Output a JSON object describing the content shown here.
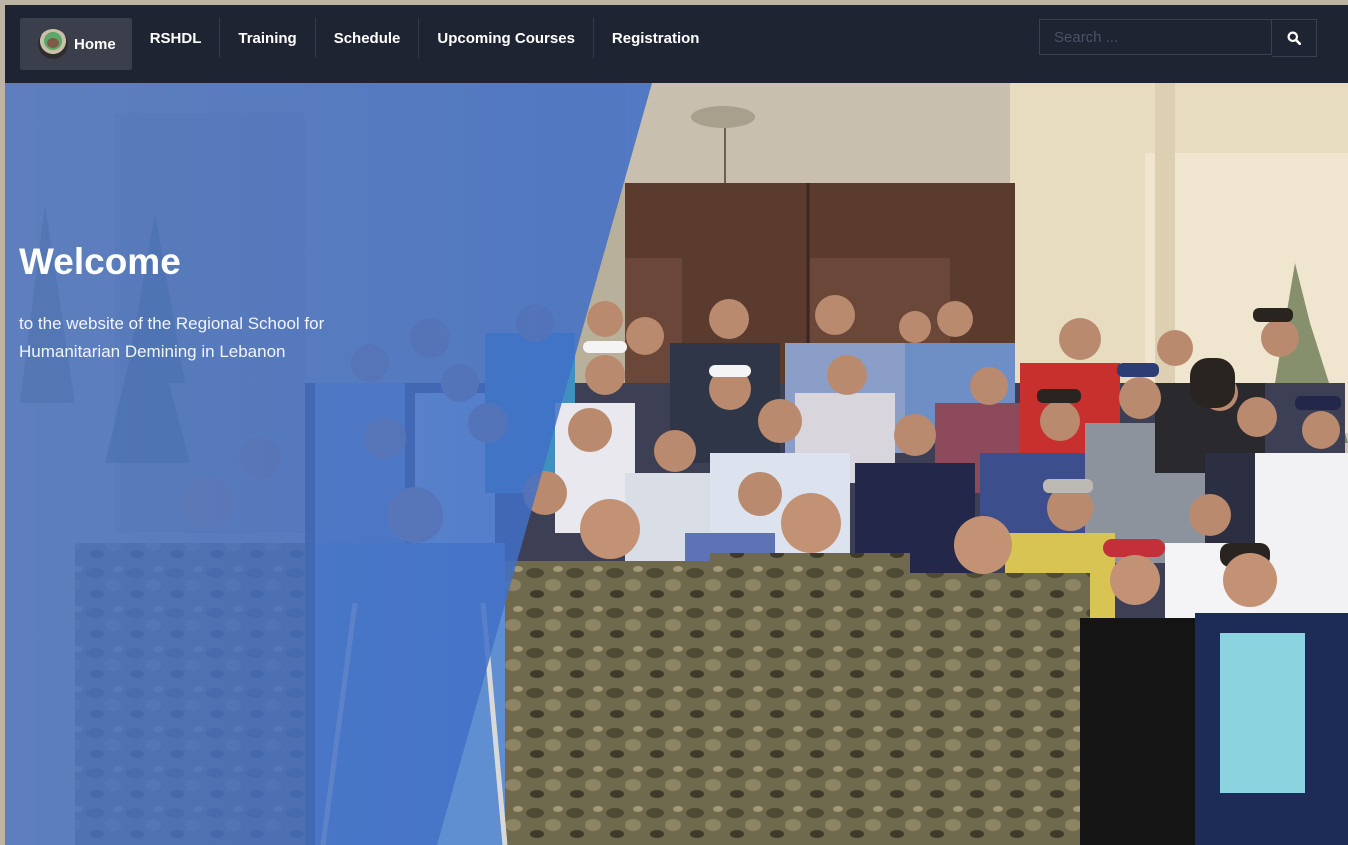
{
  "nav": {
    "items": [
      {
        "label": "Home",
        "active": true
      },
      {
        "label": "RSHDL"
      },
      {
        "label": "Training"
      },
      {
        "label": "Schedule"
      },
      {
        "label": "Upcoming Courses"
      },
      {
        "label": "Registration"
      }
    ]
  },
  "search": {
    "placeholder": "Search ...",
    "icon": "search-icon"
  },
  "hero": {
    "title": "Welcome",
    "subtitle": "to the website of the Regional School for Humanitarian Demining in Lebanon"
  },
  "colors": {
    "navbar": "#1f2433",
    "home_active": "#3b3f4c",
    "overlay_blue": "#4a74c4"
  }
}
